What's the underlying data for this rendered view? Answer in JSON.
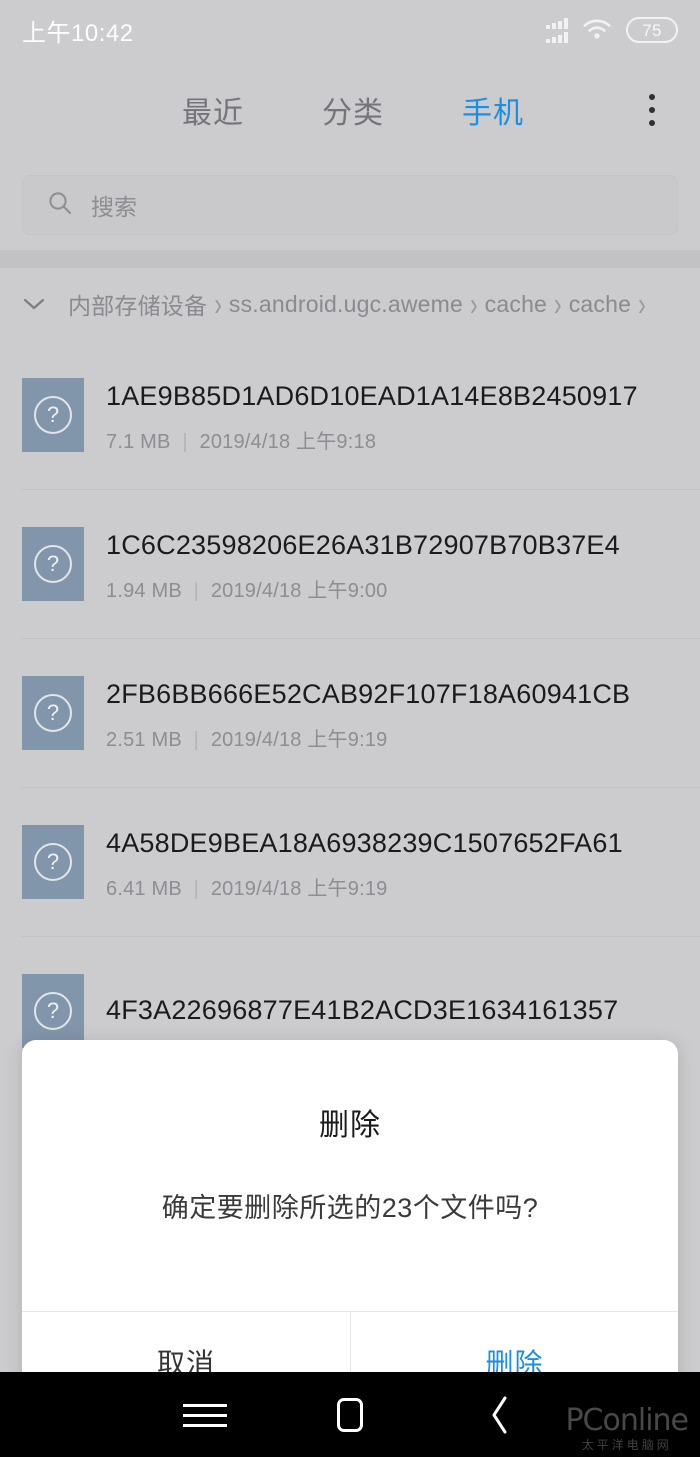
{
  "status_bar": {
    "time": "上午10:42",
    "signal_icon": "signal-bars-icon",
    "wifi_icon": "wifi-icon",
    "battery_level": "75"
  },
  "header": {
    "tabs": [
      {
        "label": "最近",
        "active": false
      },
      {
        "label": "分类",
        "active": false
      },
      {
        "label": "手机",
        "active": true
      }
    ],
    "overflow_icon": "more-vertical-icon",
    "accent_color": "#1a8fe3"
  },
  "search": {
    "icon": "search-icon",
    "placeholder": "搜索",
    "value": ""
  },
  "breadcrumb": {
    "collapse_icon": "chevron-down-icon",
    "separator": "›",
    "items": [
      "内部存储设备",
      "ss.android.ugc.aweme",
      "cache",
      "cache"
    ],
    "trailing_separator": "›"
  },
  "file_list": {
    "icon_name": "unknown-file-icon",
    "separator": "|",
    "items": [
      {
        "name": "1AE9B85D1AD6D10EAD1A14E8B2450917",
        "size": "7.1 MB",
        "date": "2019/4/18 上午9:18"
      },
      {
        "name": "1C6C23598206E26A31B72907B70B37E4",
        "size": "1.94 MB",
        "date": "2019/4/18 上午9:00"
      },
      {
        "name": "2FB6BB666E52CAB92F107F18A60941CB",
        "size": "2.51 MB",
        "date": "2019/4/18 上午9:19"
      },
      {
        "name": "4A58DE9BEA18A6938239C1507652FA61",
        "size": "6.41 MB",
        "date": "2019/4/18 上午9:19"
      },
      {
        "name": "4F3A22696877E41B2ACD3E1634161357",
        "size": "",
        "date": ""
      }
    ]
  },
  "dialog": {
    "title": "删除",
    "message": "确定要删除所选的23个文件吗?",
    "cancel_label": "取消",
    "confirm_label": "删除",
    "confirm_color": "#1a8fe3"
  },
  "nav_bar": {
    "menu_icon": "menu-icon",
    "home_icon": "home-icon",
    "back_icon": "back-chevron-icon"
  },
  "watermark": {
    "main": "PConline",
    "sub": "太平洋电脑网"
  }
}
